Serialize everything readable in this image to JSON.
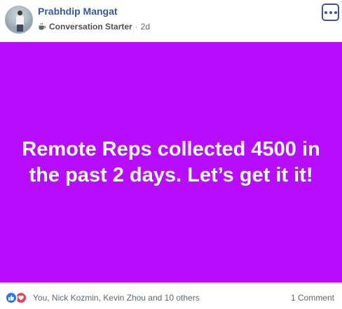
{
  "post": {
    "author": "Prabhdip Mangat",
    "badge": "Conversation Starter",
    "separator": "·",
    "time": "2d",
    "message": "Remote Reps collected 4500 in the past 2 days. Let’s get it it!",
    "background_color": "#b70cfd",
    "more_icon": "more-options-icon"
  },
  "footer": {
    "reaction_icons": [
      "like-icon",
      "love-icon"
    ],
    "likers_text": "You, Nick Kozmin, Kevin Zhou and 10 others",
    "comments_text": "1 Comment"
  }
}
